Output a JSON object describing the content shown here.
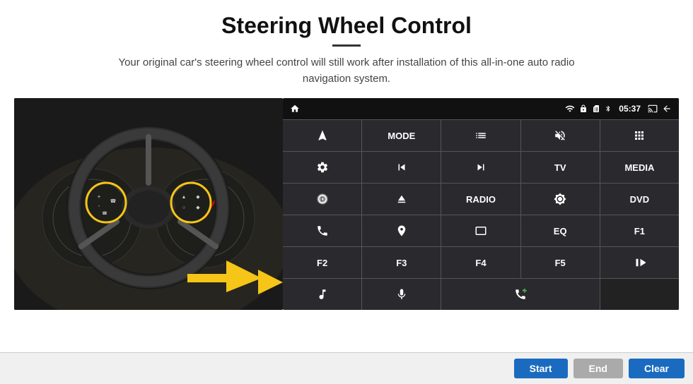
{
  "title": "Steering Wheel Control",
  "divider": true,
  "subtitle": "Your original car's steering wheel control will still work after installation of this all-in-one auto radio navigation system.",
  "status_bar": {
    "time": "05:37",
    "icons": [
      "wifi",
      "lock",
      "sim",
      "bluetooth",
      "cast",
      "back"
    ]
  },
  "grid_buttons": [
    {
      "id": "nav",
      "type": "icon",
      "icon": "nav"
    },
    {
      "id": "mode",
      "type": "text",
      "label": "MODE"
    },
    {
      "id": "list",
      "type": "icon",
      "icon": "list"
    },
    {
      "id": "mute",
      "type": "icon",
      "icon": "mute"
    },
    {
      "id": "apps",
      "type": "icon",
      "icon": "apps"
    },
    {
      "id": "settings",
      "type": "icon",
      "icon": "settings"
    },
    {
      "id": "prev",
      "type": "icon",
      "icon": "prev"
    },
    {
      "id": "next",
      "type": "icon",
      "icon": "next"
    },
    {
      "id": "tv",
      "type": "text",
      "label": "TV"
    },
    {
      "id": "media",
      "type": "text",
      "label": "MEDIA"
    },
    {
      "id": "360",
      "type": "icon",
      "icon": "360"
    },
    {
      "id": "eject",
      "type": "icon",
      "icon": "eject"
    },
    {
      "id": "radio",
      "type": "text",
      "label": "RADIO"
    },
    {
      "id": "brightness",
      "type": "icon",
      "icon": "brightness"
    },
    {
      "id": "dvd",
      "type": "text",
      "label": "DVD"
    },
    {
      "id": "phone",
      "type": "icon",
      "icon": "phone"
    },
    {
      "id": "gps",
      "type": "icon",
      "icon": "gps"
    },
    {
      "id": "screen",
      "type": "icon",
      "icon": "screen"
    },
    {
      "id": "eq",
      "type": "text",
      "label": "EQ"
    },
    {
      "id": "f1",
      "type": "text",
      "label": "F1"
    },
    {
      "id": "f2",
      "type": "text",
      "label": "F2"
    },
    {
      "id": "f3",
      "type": "text",
      "label": "F3"
    },
    {
      "id": "f4",
      "type": "text",
      "label": "F4"
    },
    {
      "id": "f5",
      "type": "text",
      "label": "F5"
    },
    {
      "id": "playpause",
      "type": "icon",
      "icon": "playpause"
    },
    {
      "id": "music",
      "type": "icon",
      "icon": "music"
    },
    {
      "id": "mic",
      "type": "icon",
      "icon": "mic"
    },
    {
      "id": "call",
      "type": "icon",
      "icon": "call"
    },
    {
      "id": "empty1",
      "type": "empty"
    },
    {
      "id": "empty2",
      "type": "empty"
    }
  ],
  "buttons": {
    "start": "Start",
    "end": "End",
    "clear": "Clear"
  }
}
